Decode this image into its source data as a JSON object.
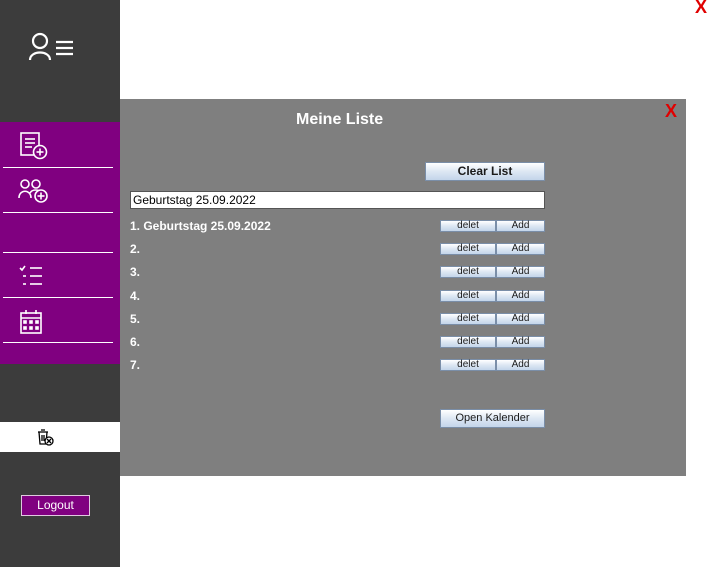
{
  "window": {
    "close_label": "X"
  },
  "sidebar": {
    "logo_icon": "user-list-icon",
    "menu_items": [
      {
        "icon": "add-note-icon"
      },
      {
        "icon": "add-group-icon"
      },
      {
        "icon": "blank"
      },
      {
        "icon": "checklist-icon"
      },
      {
        "icon": "calendar-icon"
      }
    ],
    "bin_icon": "clear-bin-icon",
    "logout_label": "Logout",
    "colors": {
      "dark": "#3c3c3c",
      "accent": "#800080"
    }
  },
  "panel": {
    "title": "Meine Liste",
    "close_label": "X",
    "clear_button_label": "Clear List",
    "input_value": "Geburtstag 25.09.2022",
    "items": [
      {
        "text": "1. Geburtstag 25.09.2022",
        "delete_label": "delet",
        "add_label": "Add"
      },
      {
        "text": "2.",
        "delete_label": "delet",
        "add_label": "Add"
      },
      {
        "text": "3.",
        "delete_label": "delet",
        "add_label": "Add"
      },
      {
        "text": "4.",
        "delete_label": "delet",
        "add_label": "Add"
      },
      {
        "text": "5.",
        "delete_label": "delet",
        "add_label": "Add"
      },
      {
        "text": "6.",
        "delete_label": "delet",
        "add_label": "Add"
      },
      {
        "text": "7.",
        "delete_label": "delet",
        "add_label": "Add"
      }
    ],
    "open_calendar_label": "Open Kalender",
    "background_color": "#7f7f7f"
  }
}
